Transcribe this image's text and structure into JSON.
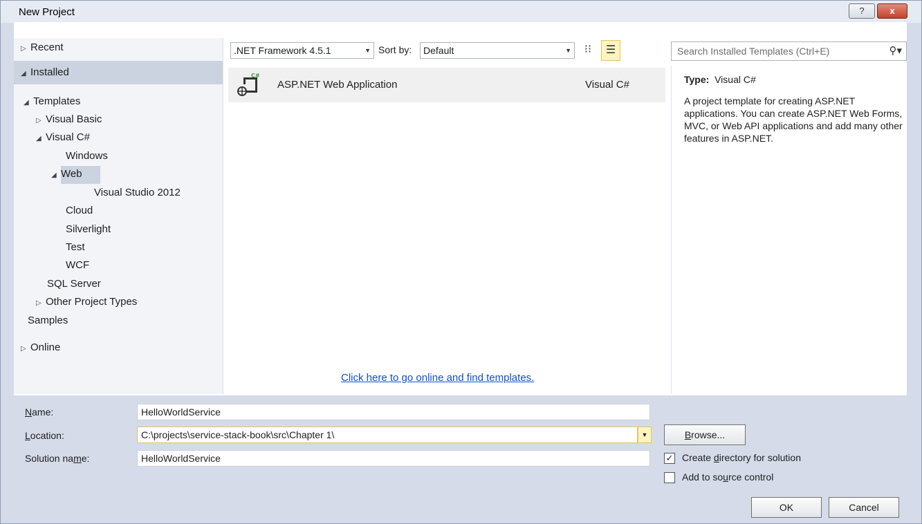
{
  "window": {
    "title": "New Project",
    "help_label": "?",
    "close_label": "x"
  },
  "tree": {
    "recent": "Recent",
    "installed": "Installed",
    "templates": "Templates",
    "visual_basic": "Visual Basic",
    "visual_csharp": "Visual C#",
    "windows": "Windows",
    "web": "Web",
    "visual_studio_2012": "Visual Studio 2012",
    "cloud": "Cloud",
    "silverlight": "Silverlight",
    "test": "Test",
    "wcf": "WCF",
    "sql_server": "SQL Server",
    "other_project_types": "Other Project Types",
    "samples": "Samples",
    "online": "Online"
  },
  "toolbar": {
    "framework": ".NET Framework 4.5.1",
    "sort_label": "Sort by:",
    "sort_value": "Default",
    "search_placeholder": "Search Installed Templates (Ctrl+E)"
  },
  "templates": [
    {
      "name": "ASP.NET Web Application",
      "language": "Visual C#",
      "icon_badge": "C#"
    }
  ],
  "online_link": "Click here to go online and find templates.",
  "info": {
    "type_label": "Type:",
    "type_value": "Visual C#",
    "description": "A project template for creating ASP.NET applications. You can create ASP.NET Web Forms, MVC,  or Web API applications and add many other features in ASP.NET."
  },
  "form": {
    "name_label_u": "N",
    "name_label_rest": "ame:",
    "name_value": "HelloWorldService",
    "location_label_u": "L",
    "location_label_rest": "ocation:",
    "location_value": "C:\\projects\\service-stack-book\\src\\Chapter 1\\",
    "solution_label_pre": "Solution na",
    "solution_label_u": "m",
    "solution_label_post": "e:",
    "solution_value": "HelloWorldService",
    "browse_u": "B",
    "browse_rest": "rowse...",
    "create_dir_pre": "Create ",
    "create_dir_u": "d",
    "create_dir_post": "irectory for solution",
    "create_dir_checked": true,
    "source_pre": "Add to so",
    "source_u": "u",
    "source_post": "rce control",
    "source_checked": false,
    "ok": "OK",
    "cancel": "Cancel"
  },
  "colors": {
    "link": "#0f4fd0",
    "selection": "#cbd3e0",
    "highlight": "#fdf4bf"
  }
}
